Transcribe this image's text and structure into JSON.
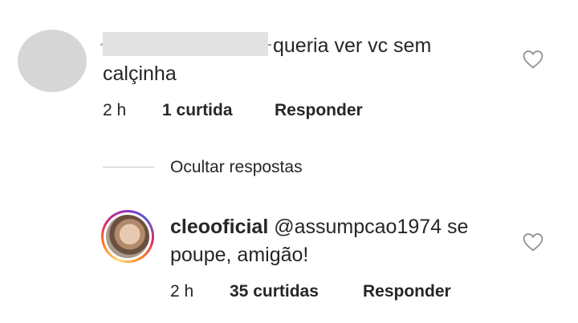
{
  "comment": {
    "text": "queria ver vc sem calçinha",
    "time": "2 h",
    "likes": "1 curtida",
    "reply_label": "Responder"
  },
  "replies_toggle": "Ocultar respostas",
  "reply": {
    "username": "cleooficial",
    "text": "@assumpcao1974 se poupe, amigão!",
    "time": "2 h",
    "likes": "35 curtidas",
    "reply_label": "Responder"
  },
  "icons": {
    "like": "heart-outline-icon"
  }
}
